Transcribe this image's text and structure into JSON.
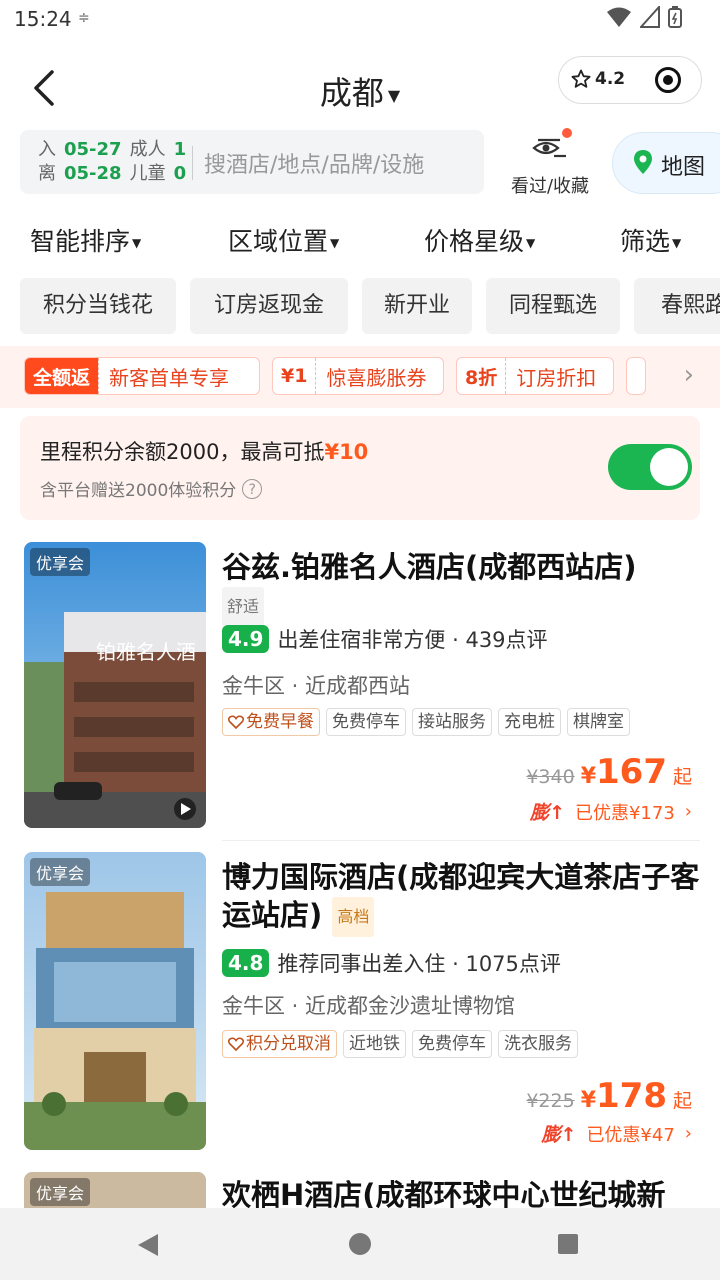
{
  "status": {
    "time": "15:24",
    "icon_text": "≑"
  },
  "header": {
    "city": "成都",
    "rating": "4.2"
  },
  "search": {
    "checkin_label": "入",
    "checkin_date": "05-27",
    "adults_label": "成人",
    "adults": "1",
    "checkout_label": "离",
    "checkout_date": "05-28",
    "children_label": "儿童",
    "children": "0",
    "placeholder": "搜酒店/地点/品牌/设施"
  },
  "history_label": "看过/收藏",
  "map_label": "地图",
  "sorts": [
    "智能排序",
    "区域位置",
    "价格星级",
    "筛选"
  ],
  "tags": [
    "积分当钱花",
    "订房返现金",
    "新开业",
    "同程甄选",
    "春熙路"
  ],
  "promos": [
    {
      "key": "全额返",
      "text": "新客首单专享"
    },
    {
      "key": "¥1",
      "text": "惊喜膨胀券"
    },
    {
      "key": "8折",
      "text": "订房折扣"
    }
  ],
  "miles": {
    "text": "里程积分余额2000，最高可抵",
    "highlight": "¥10",
    "sub": "含平台赠送2000体验积分",
    "enabled": true
  },
  "hotels": [
    {
      "vip": "优享会",
      "name": "谷兹.铂雅名人酒店(成都西站店)",
      "level": "舒适",
      "score": "4.9",
      "comment": "出差住宿非常方便 · 439点评",
      "location": "金牛区 · 近成都西站",
      "facilities": [
        "免费早餐",
        "免费停车",
        "接站服务",
        "充电桩",
        "棋牌室"
      ],
      "old_price": "¥340",
      "currency": "¥",
      "price": "167",
      "qi": "起",
      "boost": "膨",
      "discount": "已优惠¥173",
      "sign_text": "铂雅名人酒"
    },
    {
      "vip": "优享会",
      "name": "博力国际酒店(成都迎宾大道茶店子客运站店)",
      "level": "高档",
      "score": "4.8",
      "comment": "推荐同事出差入住 · 1075点评",
      "location": "金牛区 · 近成都金沙遗址博物馆",
      "facilities": [
        "积分兑取消",
        "近地铁",
        "免费停车",
        "洗衣服务"
      ],
      "old_price": "¥225",
      "currency": "¥",
      "price": "178",
      "qi": "起",
      "boost": "膨",
      "discount": "已优惠¥47"
    },
    {
      "vip": "优享会",
      "name": "欢栖H酒店(成都环球中心世纪城新"
    }
  ],
  "colors": {
    "accent_green": "#1ca04f",
    "price_orange": "#ff5a1e",
    "promo_red": "#ff4a1e"
  }
}
